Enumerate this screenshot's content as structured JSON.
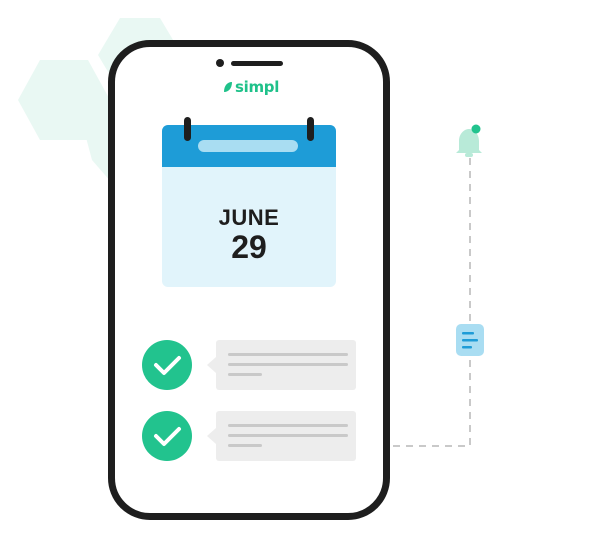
{
  "brand": {
    "name": "simpl",
    "color": "#1fc18a"
  },
  "calendar": {
    "month": "JUNE",
    "day": "29"
  },
  "checklist": [
    {
      "status": "done",
      "icon": "checkmark-icon"
    },
    {
      "status": "done",
      "icon": "checkmark-icon"
    }
  ],
  "timeline": {
    "icons": [
      "bell-icon",
      "document-icon"
    ]
  },
  "colors": {
    "accent_green": "#22c38e",
    "calendar_blue": "#1e9cd7",
    "calendar_light": "#e1f4fb",
    "bubble_gray": "#ededed",
    "frame": "#1e1e1e"
  }
}
